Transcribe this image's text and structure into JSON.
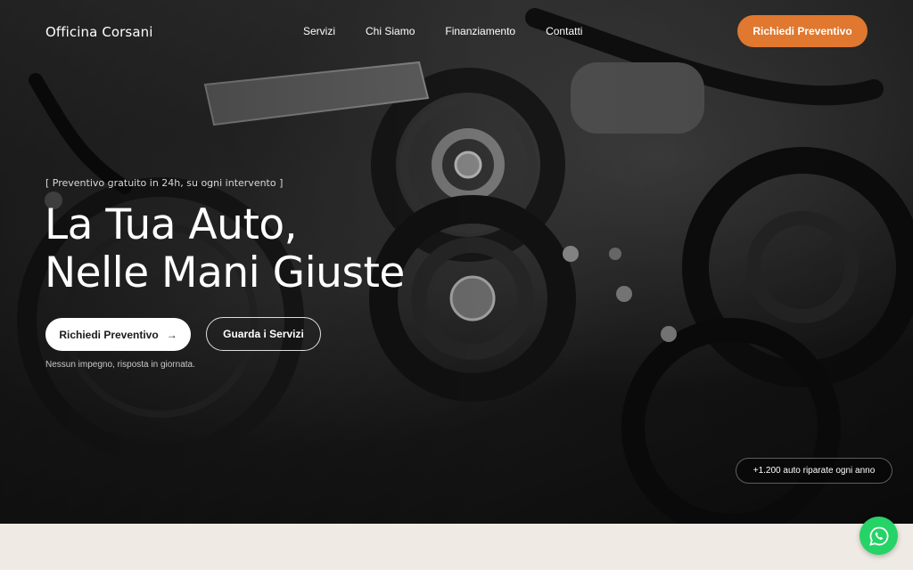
{
  "nav": {
    "logo": "Officina Corsani",
    "links": [
      {
        "label": "Servizi"
      },
      {
        "label": "Chi Siamo"
      },
      {
        "label": "Finanziamento"
      },
      {
        "label": "Contatti"
      }
    ],
    "cta_label": "Richiedi Preventivo"
  },
  "hero": {
    "eyebrow": "[ Preventivo gratuito in 24h, su ogni intervento ]",
    "title_line1": "La Tua Auto,",
    "title_line2": "Nelle Mani Giuste",
    "primary_button": "Richiedi Preventivo",
    "secondary_button": "Guarda i Servizi",
    "note": "Nessun impegno, risposta in giornata.",
    "badge": "+1.200 auto riparate ogni anno"
  },
  "icons": {
    "primary_arrow": "arrow-right-icon",
    "floating": "whatsapp-icon"
  },
  "colors": {
    "accent": "#e0782f",
    "whatsapp": "#25d366",
    "footer_bg": "#efebe4"
  }
}
